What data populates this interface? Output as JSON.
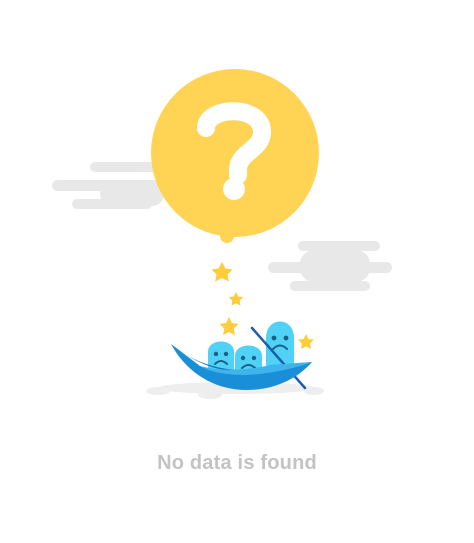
{
  "empty_state": {
    "message": "No data is found",
    "icons": {
      "question_bubble": "question-mark-bubble-icon",
      "boat": "boat-icon",
      "stars": "star-icon",
      "clouds": "cloud-icon"
    }
  },
  "colors": {
    "bubble": "#ffd455",
    "bubble_glyph": "#ffffff",
    "cloud": "#e8e8e8",
    "boat": "#1a8fd8",
    "boat_inner": "#4fc3f7",
    "characters": "#4fd2f5",
    "star": "#ffcd3c",
    "message_text": "#c3c3c3"
  }
}
